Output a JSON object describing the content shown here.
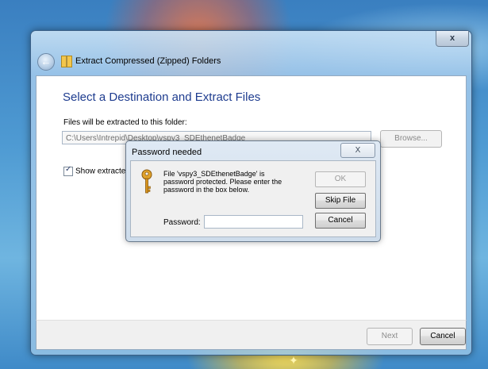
{
  "window": {
    "title": "Extract Compressed (Zipped) Folders",
    "close_glyph": "x",
    "back_glyph": "←"
  },
  "wizard": {
    "heading": "Select a Destination and Extract Files",
    "files_label": "Files will be extracted to this folder:",
    "path_value": "C:\\Users\\Intrepid\\Desktop\\vspy3_SDEthenetBadge",
    "browse_label": "Browse...",
    "show_label": "Show extracte",
    "show_checked": true,
    "check_glyph": "✓"
  },
  "footer": {
    "next_label": "Next",
    "cancel_label": "Cancel"
  },
  "password_dialog": {
    "title": "Password needed",
    "close_glyph": "X",
    "message": "File 'vspy3_SDEthenetBadge' is password protected.  Please enter the password in the box below.",
    "ok_label": "OK",
    "skip_label": "Skip File",
    "cancel_label": "Cancel",
    "password_label": "Password:",
    "password_value": ""
  },
  "icons": {
    "back": "back-arrow-icon",
    "zip": "zip-folder-icon",
    "key": "key-icon"
  },
  "colors": {
    "heading": "#1e3c8f",
    "window_frame": "#9cc3e6"
  }
}
